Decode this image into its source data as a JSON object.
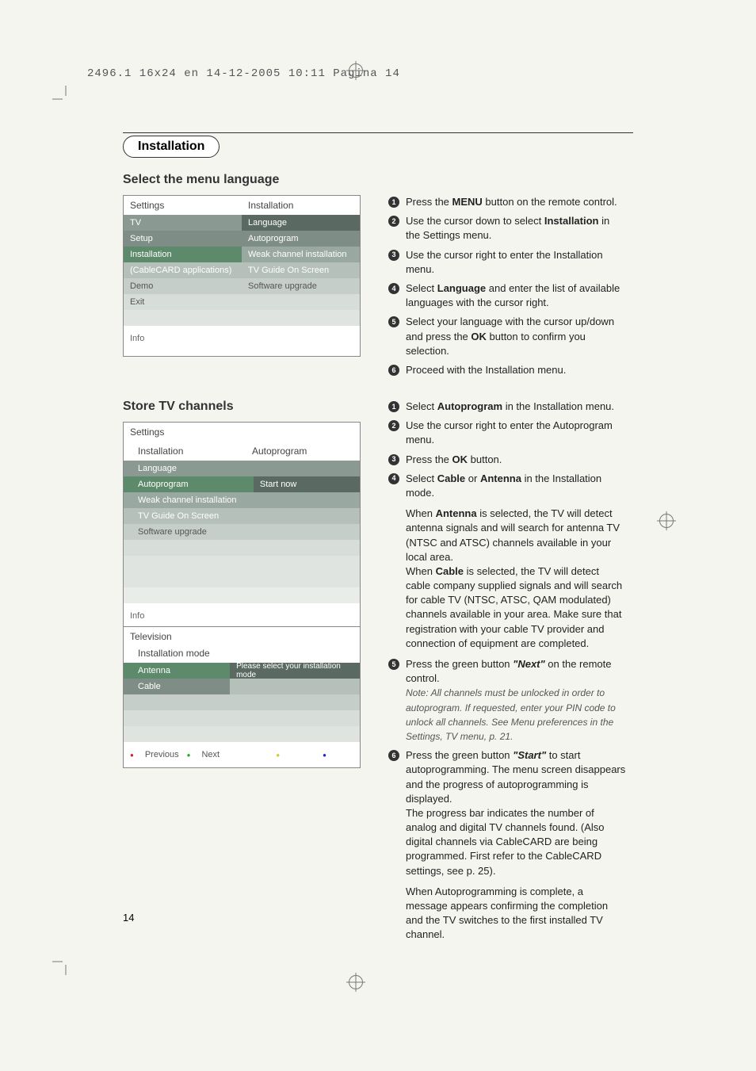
{
  "header_line": "2496.1 16x24 en  14-12-2005  10:11  Pagina 14",
  "section_title": "Installation",
  "subsection_language": "Select the menu language",
  "subsection_store": "Store TV channels",
  "panel1": {
    "title_left": "Settings",
    "title_right": "Installation",
    "left_items": [
      "TV",
      "Setup",
      "Installation",
      "(CableCARD applications)",
      "Demo",
      "Exit",
      ""
    ],
    "right_items": [
      "Language",
      "Autoprogram",
      "Weak channel installation",
      "TV Guide On Screen",
      "Software upgrade",
      "",
      ""
    ],
    "info": "Info"
  },
  "panel2": {
    "title_left": "Settings",
    "sub_left": "Installation",
    "title_right": "Autoprogram",
    "left_items": [
      "Language",
      "Autoprogram",
      "Weak channel installation",
      "TV Guide On Screen",
      "Software upgrade",
      "",
      "",
      "",
      ""
    ],
    "right_items": [
      "",
      "Start now",
      "",
      "",
      "",
      "",
      "",
      "",
      ""
    ],
    "info": "Info"
  },
  "panel3": {
    "title": "Television",
    "sub": "Installation mode",
    "left_items": [
      "Antenna",
      "Cable",
      "",
      "",
      ""
    ],
    "right_text": "Please select your installation mode",
    "footer": {
      "prev": "Previous",
      "next": "Next"
    }
  },
  "steps_lang": [
    {
      "n": "1",
      "pre": "Press the ",
      "bold": "MENU",
      "post": " button on the remote control."
    },
    {
      "n": "2",
      "pre": "Use the cursor down to select ",
      "bold": "Installation",
      "post": " in the Settings menu."
    },
    {
      "n": "3",
      "pre": "Use the cursor right to enter the Installation menu.",
      "bold": "",
      "post": ""
    },
    {
      "n": "4",
      "pre": "Select ",
      "bold": "Language",
      "post": " and enter the list of available languages with the cursor right."
    },
    {
      "n": "5",
      "pre": "Select your language with the cursor up/down and press the ",
      "bold": "OK",
      "post": " button to confirm you selection."
    },
    {
      "n": "6",
      "pre": "Proceed with the Installation menu.",
      "bold": "",
      "post": ""
    }
  ],
  "steps_store": {
    "s1": {
      "n": "1",
      "pre": "Select ",
      "bold": "Autoprogram",
      "post": " in the Installation menu."
    },
    "s2": {
      "n": "2",
      "pre": "Use the cursor right to enter the Autoprogram menu.",
      "bold": "",
      "post": ""
    },
    "s3": {
      "n": "3",
      "pre": "Press the ",
      "bold": "OK",
      "post": " button."
    },
    "s4": {
      "n": "4",
      "pre": "Select ",
      "bold": "Cable",
      "mid": " or ",
      "bold2": "Antenna",
      "post": " in the Installation mode."
    },
    "block_antenna_pre": "When ",
    "block_antenna_bold": "Antenna",
    "block_antenna_post": " is selected, the TV will detect antenna signals and will search for antenna TV (NTSC and ATSC) channels available in your local area.",
    "block_cable_pre": "When ",
    "block_cable_bold": "Cable",
    "block_cable_post": " is selected, the TV will detect cable company supplied signals and will search for cable TV (NTSC, ATSC, QAM modulated) channels available in your area. Make sure that registration with your cable TV provider and connection of equipment are completed.",
    "s5": {
      "n": "5",
      "pre": "Press the green button ",
      "bolditalic": "\"Next\"",
      "post": " on the remote control."
    },
    "note5": "Note: All channels must be unlocked in order to autoprogram. If requested, enter your PIN code to unlock all channels. See Menu preferences in the Settings, TV menu, p. 21.",
    "s6": {
      "n": "6",
      "pre": "Press the green button ",
      "bolditalic": "\"Start\"",
      "post": " to start autoprogramming. The menu screen disappears and the progress of autoprogramming is displayed."
    },
    "s6b": "The progress bar indicates the number of analog and digital TV channels found. (Also digital channels via CableCARD are being programmed. First refer to the CableCARD settings, see p. 25).",
    "final": "When Autoprogramming is complete, a message appears confirming the completion and the TV switches to the first installed TV channel."
  },
  "page_number": "14"
}
